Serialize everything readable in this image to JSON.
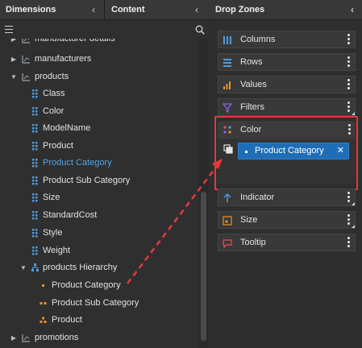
{
  "left_panel": {
    "tabs": [
      {
        "label": "Dimensions"
      },
      {
        "label": "Content"
      }
    ],
    "tree": [
      {
        "label": "manufacturer details",
        "kind": "table",
        "expanded": false
      },
      {
        "label": "manufacturers",
        "kind": "table",
        "expanded": false
      },
      {
        "label": "products",
        "kind": "table",
        "expanded": true
      },
      {
        "label": "Class",
        "kind": "field"
      },
      {
        "label": "Color",
        "kind": "field"
      },
      {
        "label": "ModelName",
        "kind": "field"
      },
      {
        "label": "Product",
        "kind": "field"
      },
      {
        "label": "Product Category",
        "kind": "field",
        "highlighted": true
      },
      {
        "label": "Product Sub Category",
        "kind": "field"
      },
      {
        "label": "Size",
        "kind": "field"
      },
      {
        "label": "StandardCost",
        "kind": "field"
      },
      {
        "label": "Style",
        "kind": "field"
      },
      {
        "label": "Weight",
        "kind": "field"
      },
      {
        "label": "products Hierarchy",
        "kind": "hierarchy",
        "expanded": true
      },
      {
        "label": "Product Category",
        "kind": "level1"
      },
      {
        "label": "Product Sub Category",
        "kind": "level2"
      },
      {
        "label": "Product",
        "kind": "level3"
      },
      {
        "label": "promotions",
        "kind": "table",
        "expanded": false
      }
    ]
  },
  "right_panel": {
    "title": "Drop Zones",
    "zones": [
      {
        "label": "Columns",
        "icon": "columns-icon"
      },
      {
        "label": "Rows",
        "icon": "rows-icon"
      },
      {
        "label": "Values",
        "icon": "values-icon"
      },
      {
        "label": "Filters",
        "icon": "filter-icon"
      },
      {
        "label": "Color",
        "icon": "color-icon"
      },
      {
        "label": "Indicator",
        "icon": "indicator-icon"
      },
      {
        "label": "Size",
        "icon": "size-icon"
      },
      {
        "label": "Tooltip",
        "icon": "tooltip-icon"
      }
    ],
    "color_chip": {
      "label": "Product Category",
      "remove": "✕"
    }
  },
  "colors": {
    "accent": "#1f6eb5",
    "highlight_text": "#4ea6ee",
    "annotation_red": "#e03a3a",
    "icon_blue": "#4d9de0",
    "icon_orange": "#e8902a",
    "icon_purple": "#8c6bd6"
  }
}
